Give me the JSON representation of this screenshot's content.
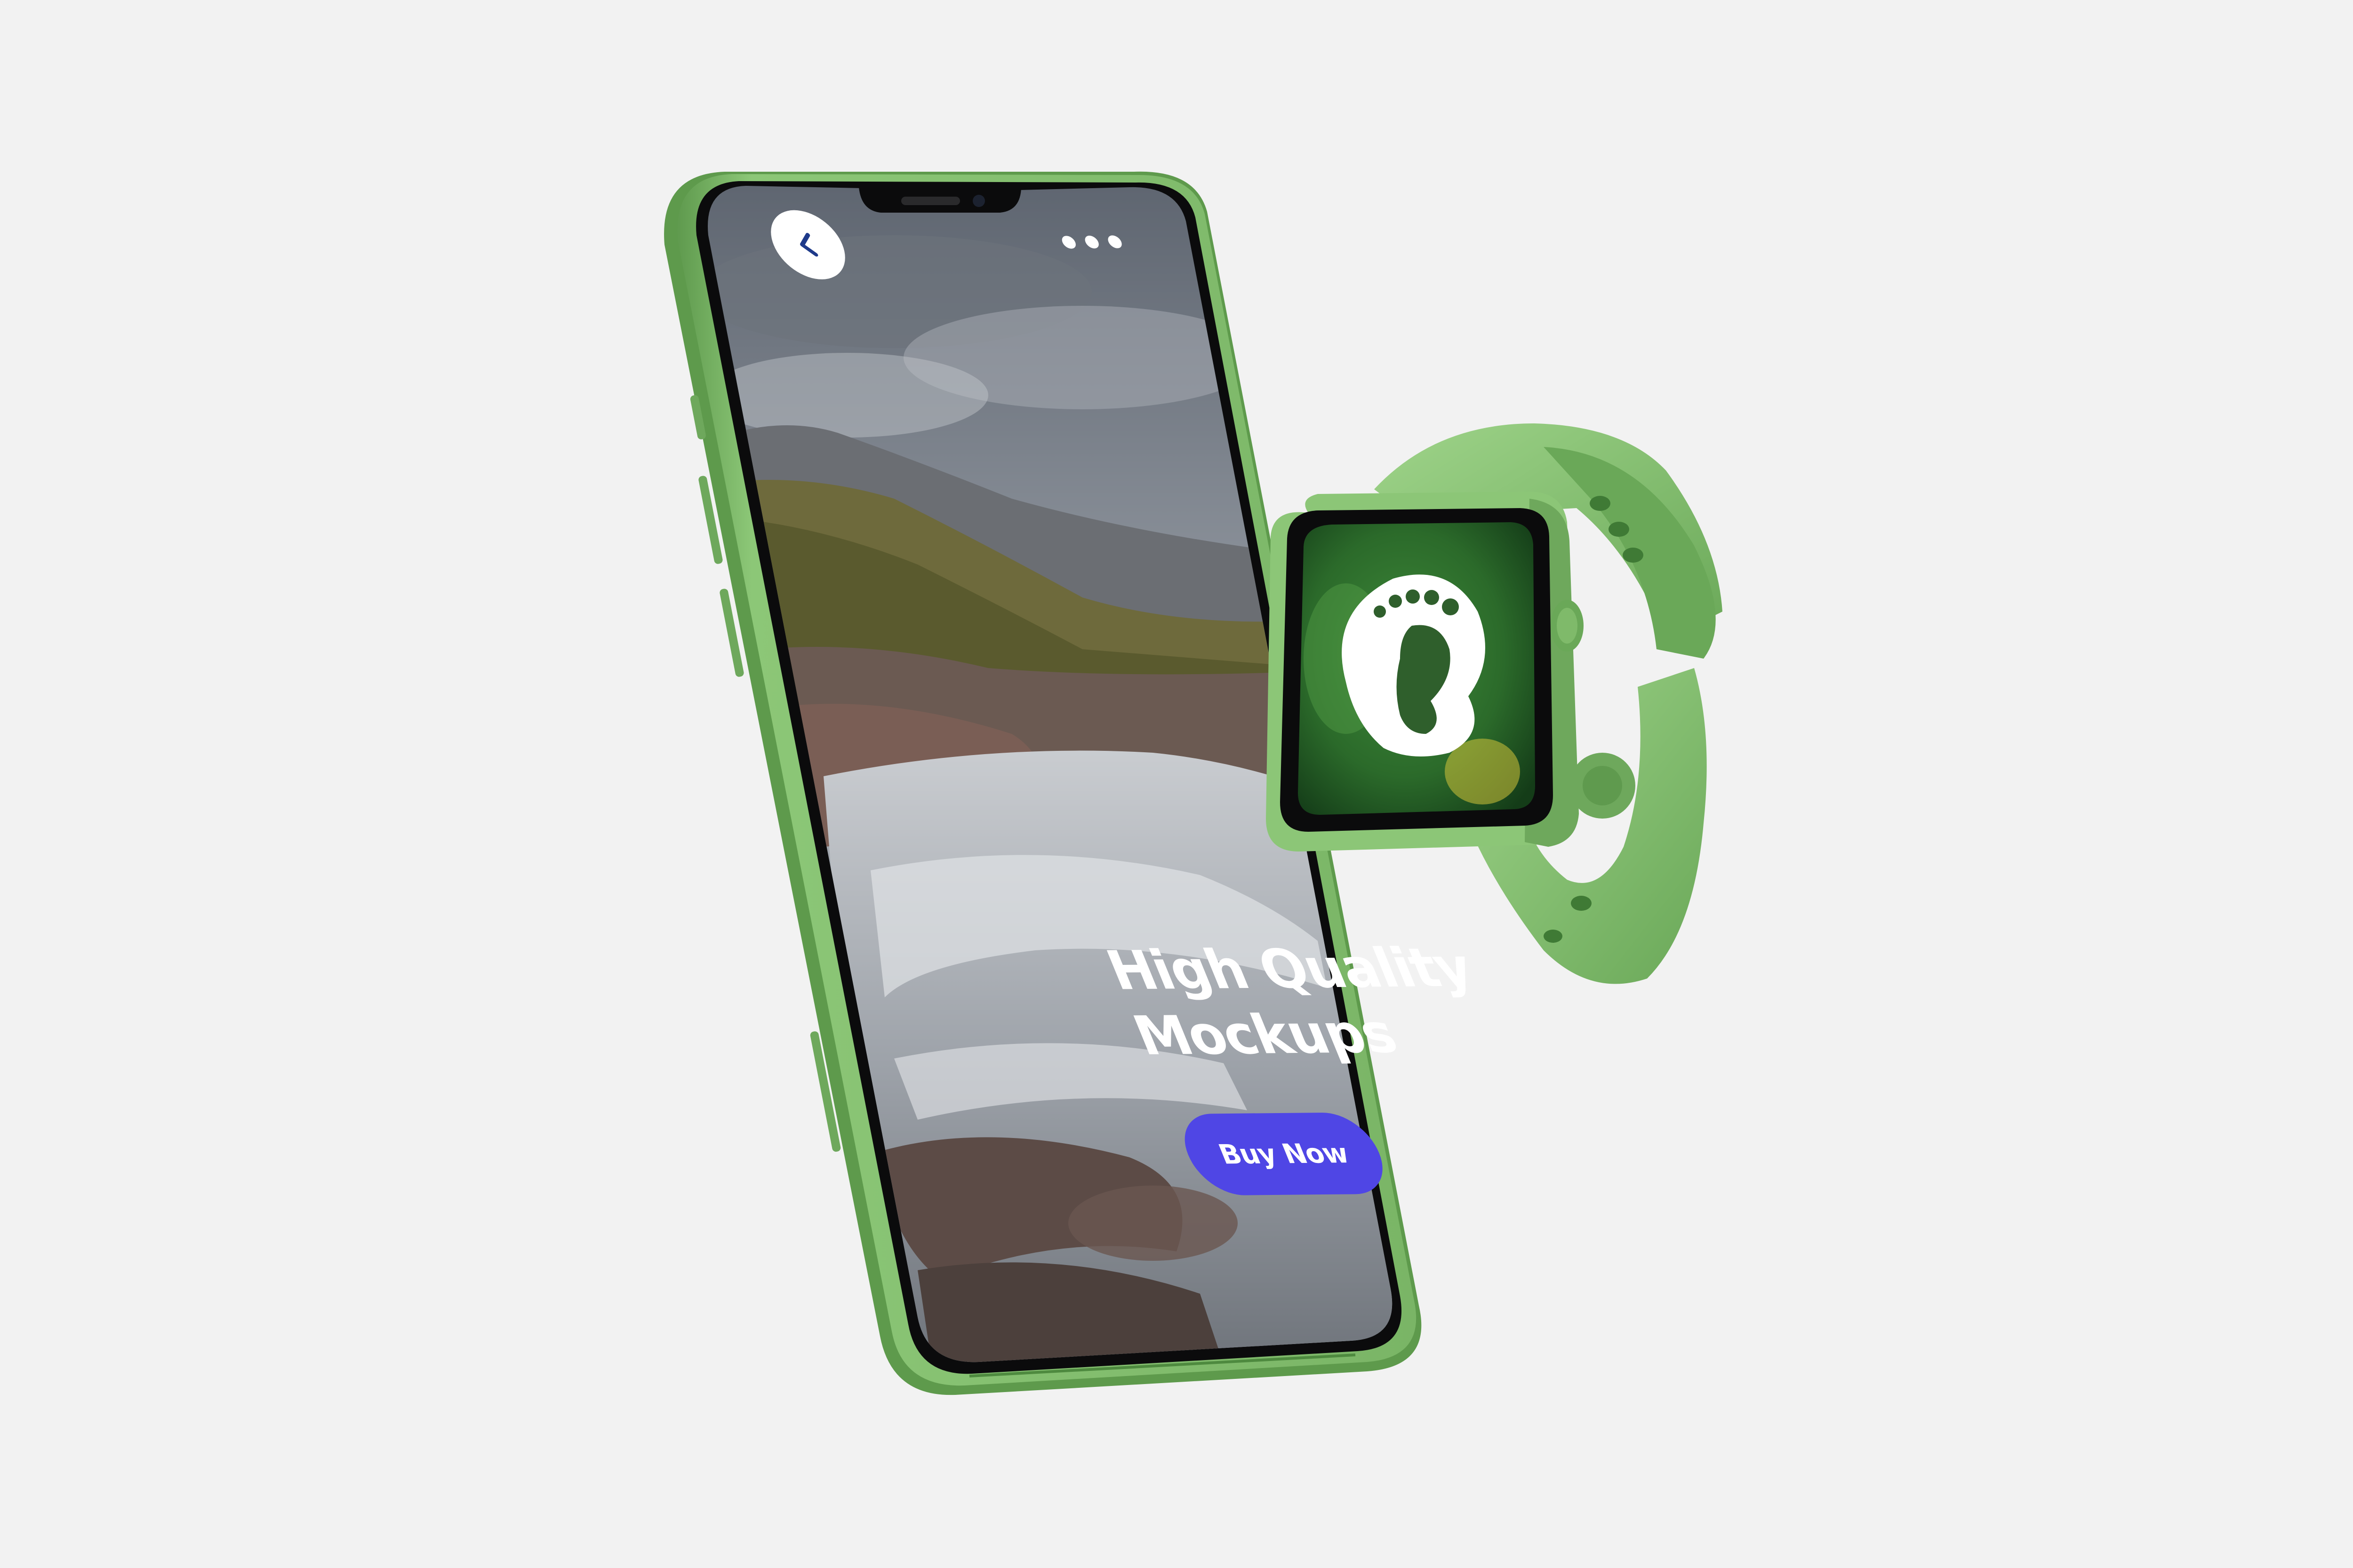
{
  "phone": {
    "headline_line1": "High Quality",
    "headline_line2": "Mockups",
    "cta_label": "Buy Now",
    "icons": {
      "back": "chevron-left-icon",
      "more": "more-horizontal-icon"
    }
  },
  "watch": {
    "icon": "footprint-icon"
  },
  "colors": {
    "background": "#f2f2f2",
    "device_green": "#7fb86a",
    "button": "#4f46e5",
    "back_chevron": "#1e3a8a"
  }
}
